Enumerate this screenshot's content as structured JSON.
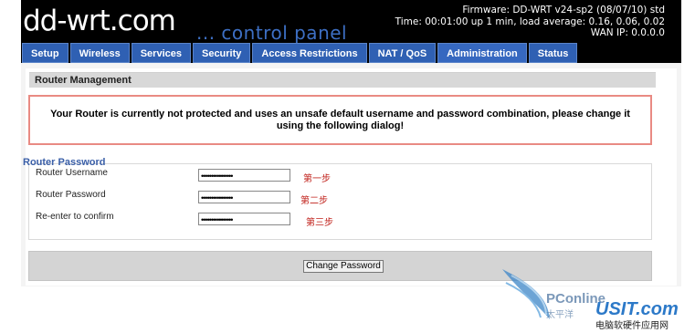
{
  "header": {
    "logo": "dd-wrt.com",
    "tagline": "... control panel",
    "firmware": "Firmware: DD-WRT v24-sp2 (08/07/10) std",
    "time": "Time: 00:01:00 up 1 min, load average: 0.16, 0.06, 0.02",
    "wan_ip": "WAN IP: 0.0.0.0"
  },
  "tabs": [
    "Setup",
    "Wireless",
    "Services",
    "Security",
    "Access Restrictions",
    "NAT / QoS",
    "Administration",
    "Status"
  ],
  "active_tab": "Administration",
  "section_title": "Router Management",
  "warning": "Your Router is currently not protected and uses an unsafe default username and password combination, please change it using the following dialog!",
  "fieldset": {
    "legend": "Router Password",
    "rows": [
      {
        "label": "Router Username",
        "value": "••••••••••••••••",
        "note": "第一步"
      },
      {
        "label": "Router Password",
        "value": "••••••••••••••••",
        "note": "第二步"
      },
      {
        "label": "Re-enter to confirm",
        "value": "••••••••••••••••",
        "note": "第三步"
      }
    ]
  },
  "button_label": "Change Password",
  "watermark": {
    "brand": "PConline",
    "site": "USIT.com",
    "caption": "电脑软硬件应用网",
    "sub": "太平洋"
  },
  "colors": {
    "tab_bg": "#2f60b3",
    "warning_border": "#e98a83",
    "note_red": "#c0201a",
    "legend_blue": "#3a5fa8"
  }
}
